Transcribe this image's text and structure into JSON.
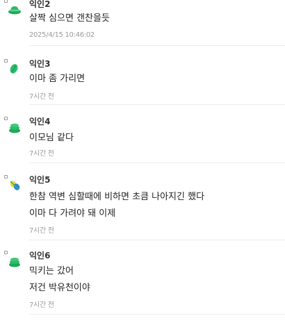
{
  "comments": [
    {
      "author": "익인2",
      "lines": [
        "살짝 심으면 갠찬을듯"
      ],
      "time": "2025/4/15 10:46:02",
      "icon": "green-hat-icon"
    },
    {
      "author": "익인3",
      "lines": [
        "이마 좀 가리면"
      ],
      "time": "7시간 전",
      "icon": "green-leaf-icon"
    },
    {
      "author": "익인4",
      "lines": [
        "이모님 같다"
      ],
      "time": "7시간 전",
      "icon": "green-hat-icon"
    },
    {
      "author": "익인5",
      "lines": [
        "한참 역변 심할때에 비하면 초큼 나아지긴 했다",
        "이마 다 가려야 돼 이제"
      ],
      "time": "7시간 전",
      "icon": "yellow-blue-leaf-icon"
    },
    {
      "author": "익인6",
      "lines": [
        "믹키는 갔어",
        "저건 박유천이야"
      ],
      "time": "7시간 전",
      "icon": "green-hat-icon"
    }
  ],
  "colors": {
    "accent_green": "#2dbb6a",
    "text": "#222222",
    "muted": "#9a9a9a",
    "divider": "#ececec"
  }
}
